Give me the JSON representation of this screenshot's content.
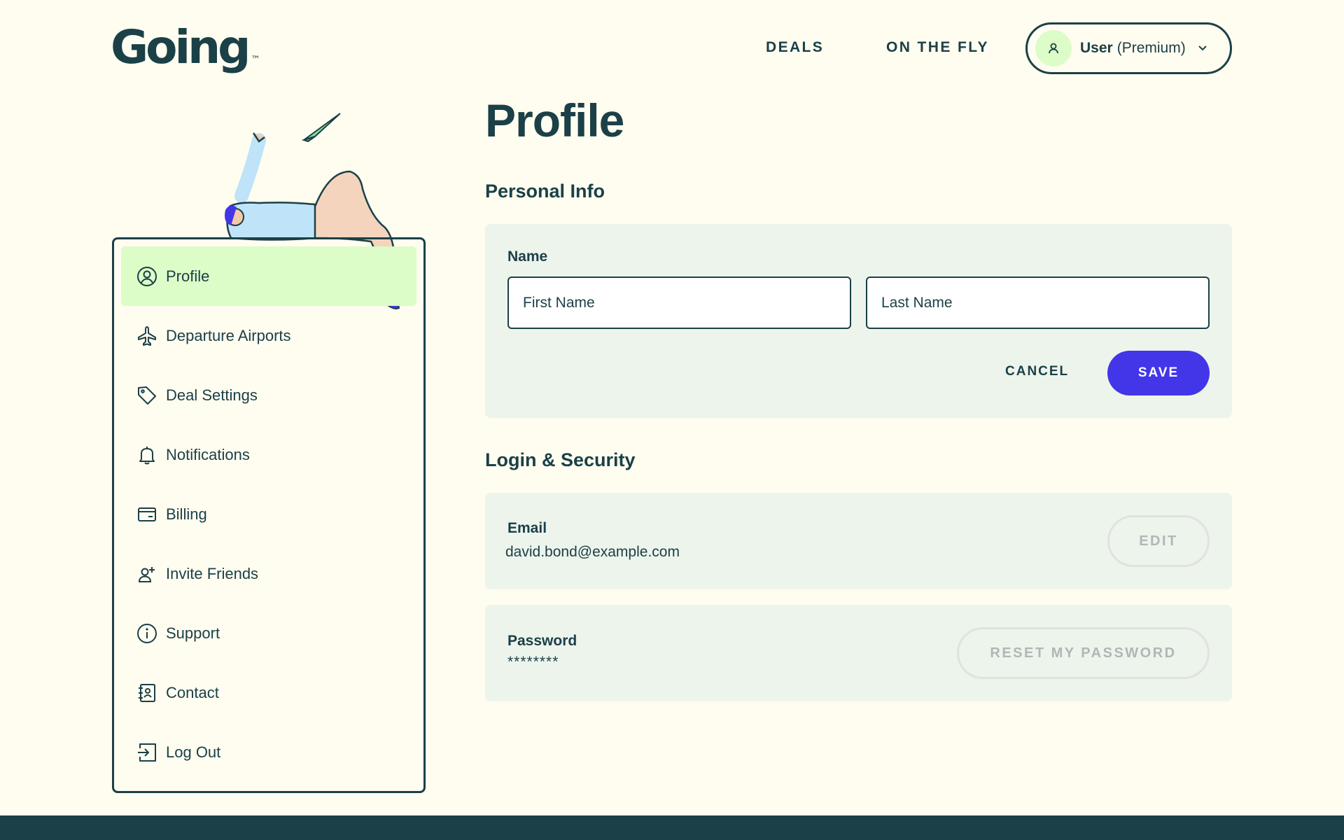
{
  "brand": {
    "logo_text": "Going",
    "trademark": "™"
  },
  "nav": {
    "deals": "DEALS",
    "on_the_fly": "ON THE FLY"
  },
  "user_menu": {
    "name": "User",
    "plan": "(Premium)"
  },
  "page": {
    "title": "Profile"
  },
  "sidebar": {
    "items": [
      {
        "label": "Profile",
        "icon": "user-circle-icon",
        "active": true
      },
      {
        "label": "Departure Airports",
        "icon": "airplane-icon"
      },
      {
        "label": "Deal Settings",
        "icon": "tag-icon"
      },
      {
        "label": "Notifications",
        "icon": "bell-icon"
      },
      {
        "label": "Billing",
        "icon": "credit-card-icon"
      },
      {
        "label": "Invite Friends",
        "icon": "user-plus-icon"
      },
      {
        "label": "Support",
        "icon": "info-icon"
      },
      {
        "label": "Contact",
        "icon": "address-book-icon"
      },
      {
        "label": "Log Out",
        "icon": "log-out-icon"
      }
    ]
  },
  "personal_info": {
    "title": "Personal Info",
    "name_label": "Name",
    "first_name_placeholder": "First Name",
    "last_name_placeholder": "Last Name",
    "cancel_label": "CANCEL",
    "save_label": "SAVE"
  },
  "login_security": {
    "title": "Login & Security",
    "email_label": "Email",
    "email_value": "david.bond@example.com",
    "edit_label": "EDIT",
    "password_label": "Password",
    "password_value": "********",
    "reset_label": "RESET MY PASSWORD"
  },
  "colors": {
    "background": "#fffdf0",
    "text": "#1b4047",
    "accent_green": "#dcfcc8",
    "card": "#edf4ec",
    "primary_button": "#4335e8",
    "footer": "#1b4047"
  }
}
